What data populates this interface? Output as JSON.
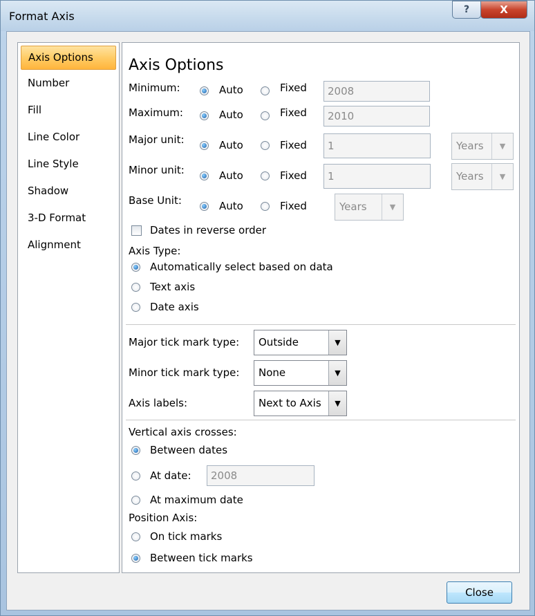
{
  "window": {
    "title": "Format Axis",
    "help_icon": "?",
    "close_icon": "X"
  },
  "nav": {
    "items": [
      {
        "label": "Axis Options",
        "selected": true
      },
      {
        "label": "Number"
      },
      {
        "label": "Fill"
      },
      {
        "label": "Line Color"
      },
      {
        "label": "Line Style"
      },
      {
        "label": "Shadow"
      },
      {
        "label": "3-D Format"
      },
      {
        "label": "Alignment"
      }
    ]
  },
  "panel": {
    "title": "Axis Options",
    "rows": {
      "minimum": {
        "label": "Minimum:",
        "auto": "Auto",
        "fixed": "Fixed",
        "value": "2008",
        "selected": "auto"
      },
      "maximum": {
        "label": "Maximum:",
        "auto": "Auto",
        "fixed": "Fixed",
        "value": "2010",
        "selected": "auto"
      },
      "major_unit": {
        "label": "Major unit:",
        "auto": "Auto",
        "fixed": "Fixed",
        "value": "1",
        "unit": "Years",
        "selected": "auto"
      },
      "minor_unit": {
        "label": "Minor unit:",
        "auto": "Auto",
        "fixed": "Fixed",
        "value": "1",
        "unit": "Years",
        "selected": "auto"
      },
      "base_unit": {
        "label": "Base Unit:",
        "auto": "Auto",
        "fixed": "Fixed",
        "unit": "Years",
        "selected": "auto"
      }
    },
    "dates_reverse": {
      "label": "Dates in reverse order",
      "checked": false
    },
    "axis_type": {
      "label": "Axis Type:",
      "options": [
        "Automatically select based on data",
        "Text axis",
        "Date axis"
      ],
      "selected": 0
    },
    "tick": {
      "major_label": "Major tick mark type:",
      "major_value": "Outside",
      "minor_label": "Minor tick mark type:",
      "minor_value": "None",
      "axis_labels_label": "Axis labels:",
      "axis_labels_value": "Next to Axis"
    },
    "crosses": {
      "label": "Vertical axis crosses:",
      "between_dates": "Between dates",
      "at_date": "At date:",
      "at_date_value": "2008",
      "at_max": "At maximum date",
      "selected": "between_dates"
    },
    "position": {
      "label": "Position Axis:",
      "on_tick": "On tick marks",
      "between_tick": "Between tick marks",
      "selected": "between_tick"
    }
  },
  "buttons": {
    "close": "Close"
  }
}
